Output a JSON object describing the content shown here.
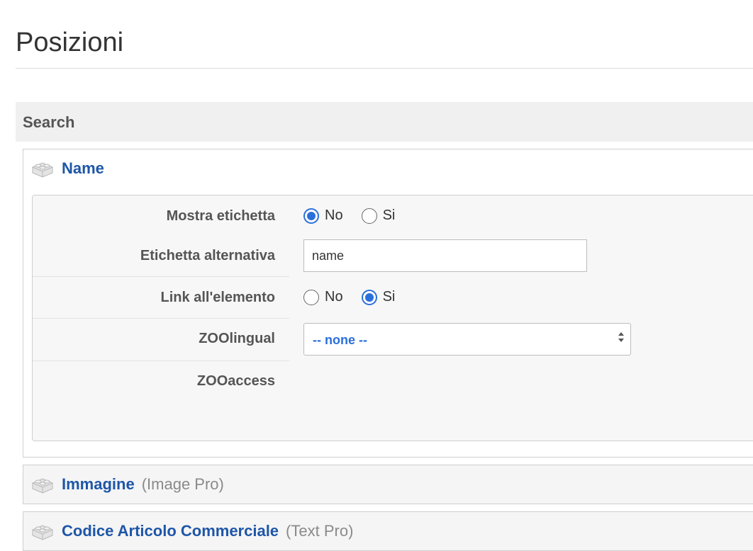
{
  "page": {
    "title": "Posizioni"
  },
  "section": {
    "title": "Search"
  },
  "elements": [
    {
      "name": "Name",
      "type": "",
      "icon": "lego-block-icon",
      "params": {
        "show_label": {
          "label": "Mostra etichetta",
          "options": [
            "No",
            "Si"
          ],
          "selected": "No"
        },
        "alt_label": {
          "label": "Etichetta alternativa",
          "value": "name"
        },
        "link_to_item": {
          "label": "Link all'elemento",
          "options": [
            "No",
            "Si"
          ],
          "selected": "Si"
        },
        "zoolingual": {
          "label": "ZOOlingual",
          "value": "-- none --"
        },
        "zooaccess": {
          "label": "ZOOaccess"
        }
      }
    },
    {
      "name": "Immagine",
      "type": "(Image Pro)",
      "icon": "lego-block-icon"
    },
    {
      "name": "Codice Articolo Commerciale",
      "type": "(Text Pro)",
      "icon": "lego-block-icon"
    }
  ],
  "colors": {
    "link": "#1e56a8",
    "accent": "#2a6fdb",
    "section_bg": "#f0f0f0",
    "panel_bg": "#f7f7f7"
  }
}
